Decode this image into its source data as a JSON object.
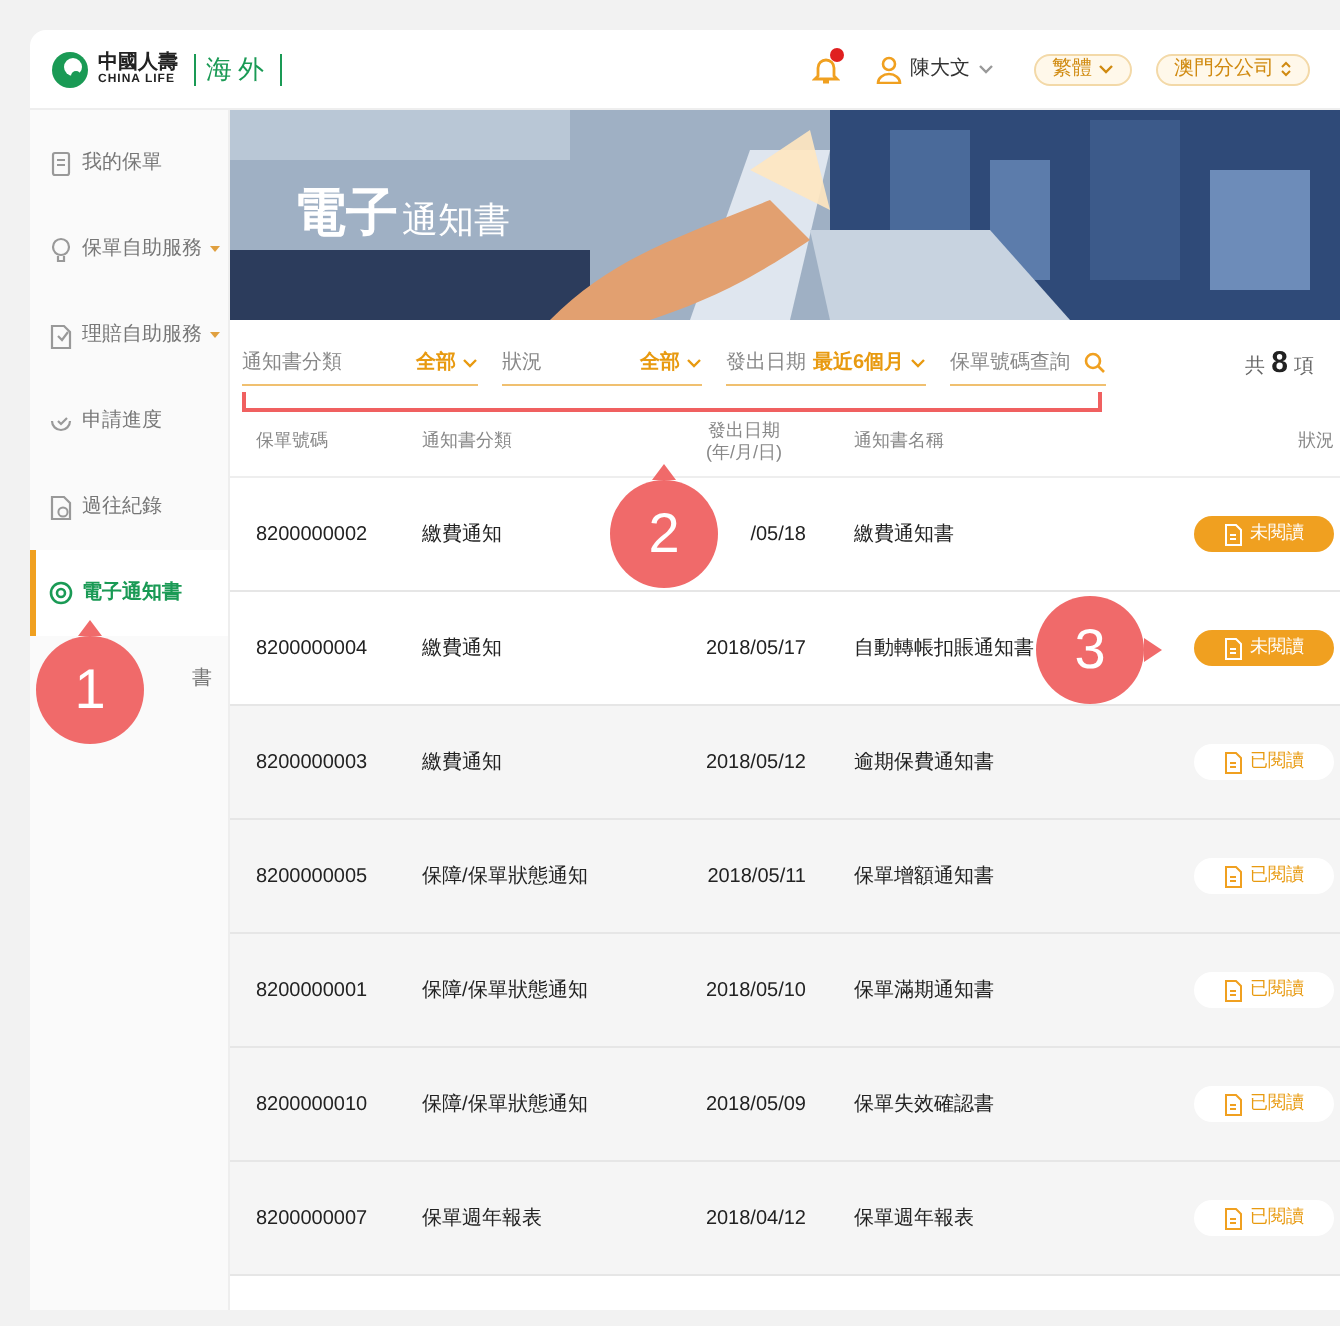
{
  "header": {
    "logo_cn": "中國人壽",
    "logo_en": "CHINA LIFE",
    "logo_region": "海外",
    "notifications": {
      "unread": true
    },
    "user": "陳大文",
    "language": "繁體",
    "branch": "澳門分公司"
  },
  "sidebar": {
    "items": [
      {
        "label": "我的保單",
        "expandable": false,
        "selected": false
      },
      {
        "label": "保單自助服務",
        "expandable": true,
        "selected": false
      },
      {
        "label": "理賠自助服務",
        "expandable": true,
        "selected": false
      },
      {
        "label": "申請進度",
        "expandable": false,
        "selected": false
      },
      {
        "label": "過往紀錄",
        "expandable": false,
        "selected": false
      },
      {
        "label": "電子通知書",
        "expandable": false,
        "selected": true
      },
      {
        "label": "書",
        "expandable": false,
        "selected": false
      }
    ]
  },
  "banner": {
    "kind": "picture",
    "title_big": "電子",
    "title_small": "通知書"
  },
  "filters": [
    {
      "kind": "select",
      "label": "通知書分類",
      "value": "全部"
    },
    {
      "kind": "select",
      "label": "狀況",
      "value": "全部"
    },
    {
      "kind": "select",
      "label": "發出日期",
      "value": "最近6個月"
    },
    {
      "kind": "search",
      "placeholder": "保單號碼查詢"
    }
  ],
  "total": {
    "prefix": "共",
    "count": "8",
    "suffix": "項"
  },
  "table": {
    "columns": [
      "保單號碼",
      "通知書分類",
      "發出日期\n(年/月/日)",
      "通知書名稱",
      "狀況"
    ],
    "rows": [
      {
        "policy": "8200000002",
        "category": "繳費通知",
        "date": "/05/18",
        "name": "繳費通知書",
        "status": "未閱讀",
        "read": false
      },
      {
        "policy": "8200000004",
        "category": "繳費通知",
        "date": "2018/05/17",
        "name": "自動轉帳扣賬通知書",
        "status": "未閱讀",
        "read": false
      },
      {
        "policy": "8200000003",
        "category": "繳費通知",
        "date": "2018/05/12",
        "name": "逾期保費通知書",
        "status": "已閱讀",
        "read": true
      },
      {
        "policy": "8200000005",
        "category": "保障/保單狀態通知",
        "date": "2018/05/11",
        "name": "保單增額通知書",
        "status": "已閱讀",
        "read": true
      },
      {
        "policy": "8200000001",
        "category": "保障/保單狀態通知",
        "date": "2018/05/10",
        "name": "保單滿期通知書",
        "status": "已閱讀",
        "read": true
      },
      {
        "policy": "8200000010",
        "category": "保障/保單狀態通知",
        "date": "2018/05/09",
        "name": "保單失效確認書",
        "status": "已閱讀",
        "read": true
      },
      {
        "policy": "8200000007",
        "category": "保單週年報表",
        "date": "2018/04/12",
        "name": "保單週年報表",
        "status": "已閱讀",
        "read": true
      }
    ]
  },
  "annotations": [
    {
      "label": "1"
    },
    {
      "label": "2"
    },
    {
      "label": "3"
    }
  ]
}
